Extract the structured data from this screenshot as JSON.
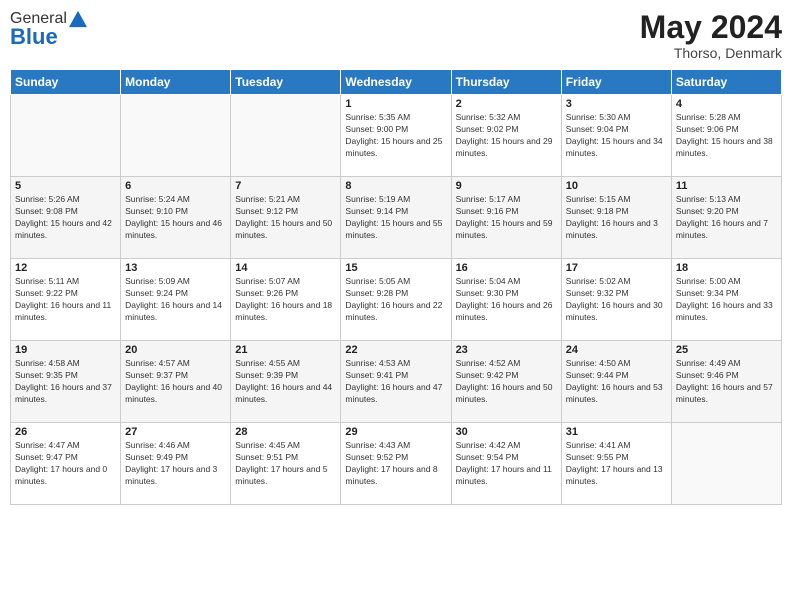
{
  "header": {
    "logo_general": "General",
    "logo_blue": "Blue",
    "month_title": "May 2024",
    "subtitle": "Thorso, Denmark"
  },
  "days_of_week": [
    "Sunday",
    "Monday",
    "Tuesday",
    "Wednesday",
    "Thursday",
    "Friday",
    "Saturday"
  ],
  "weeks": [
    [
      {
        "day": "",
        "info": ""
      },
      {
        "day": "",
        "info": ""
      },
      {
        "day": "",
        "info": ""
      },
      {
        "day": "1",
        "info": "Sunrise: 5:35 AM\nSunset: 9:00 PM\nDaylight: 15 hours and 25 minutes."
      },
      {
        "day": "2",
        "info": "Sunrise: 5:32 AM\nSunset: 9:02 PM\nDaylight: 15 hours and 29 minutes."
      },
      {
        "day": "3",
        "info": "Sunrise: 5:30 AM\nSunset: 9:04 PM\nDaylight: 15 hours and 34 minutes."
      },
      {
        "day": "4",
        "info": "Sunrise: 5:28 AM\nSunset: 9:06 PM\nDaylight: 15 hours and 38 minutes."
      }
    ],
    [
      {
        "day": "5",
        "info": "Sunrise: 5:26 AM\nSunset: 9:08 PM\nDaylight: 15 hours and 42 minutes."
      },
      {
        "day": "6",
        "info": "Sunrise: 5:24 AM\nSunset: 9:10 PM\nDaylight: 15 hours and 46 minutes."
      },
      {
        "day": "7",
        "info": "Sunrise: 5:21 AM\nSunset: 9:12 PM\nDaylight: 15 hours and 50 minutes."
      },
      {
        "day": "8",
        "info": "Sunrise: 5:19 AM\nSunset: 9:14 PM\nDaylight: 15 hours and 55 minutes."
      },
      {
        "day": "9",
        "info": "Sunrise: 5:17 AM\nSunset: 9:16 PM\nDaylight: 15 hours and 59 minutes."
      },
      {
        "day": "10",
        "info": "Sunrise: 5:15 AM\nSunset: 9:18 PM\nDaylight: 16 hours and 3 minutes."
      },
      {
        "day": "11",
        "info": "Sunrise: 5:13 AM\nSunset: 9:20 PM\nDaylight: 16 hours and 7 minutes."
      }
    ],
    [
      {
        "day": "12",
        "info": "Sunrise: 5:11 AM\nSunset: 9:22 PM\nDaylight: 16 hours and 11 minutes."
      },
      {
        "day": "13",
        "info": "Sunrise: 5:09 AM\nSunset: 9:24 PM\nDaylight: 16 hours and 14 minutes."
      },
      {
        "day": "14",
        "info": "Sunrise: 5:07 AM\nSunset: 9:26 PM\nDaylight: 16 hours and 18 minutes."
      },
      {
        "day": "15",
        "info": "Sunrise: 5:05 AM\nSunset: 9:28 PM\nDaylight: 16 hours and 22 minutes."
      },
      {
        "day": "16",
        "info": "Sunrise: 5:04 AM\nSunset: 9:30 PM\nDaylight: 16 hours and 26 minutes."
      },
      {
        "day": "17",
        "info": "Sunrise: 5:02 AM\nSunset: 9:32 PM\nDaylight: 16 hours and 30 minutes."
      },
      {
        "day": "18",
        "info": "Sunrise: 5:00 AM\nSunset: 9:34 PM\nDaylight: 16 hours and 33 minutes."
      }
    ],
    [
      {
        "day": "19",
        "info": "Sunrise: 4:58 AM\nSunset: 9:35 PM\nDaylight: 16 hours and 37 minutes."
      },
      {
        "day": "20",
        "info": "Sunrise: 4:57 AM\nSunset: 9:37 PM\nDaylight: 16 hours and 40 minutes."
      },
      {
        "day": "21",
        "info": "Sunrise: 4:55 AM\nSunset: 9:39 PM\nDaylight: 16 hours and 44 minutes."
      },
      {
        "day": "22",
        "info": "Sunrise: 4:53 AM\nSunset: 9:41 PM\nDaylight: 16 hours and 47 minutes."
      },
      {
        "day": "23",
        "info": "Sunrise: 4:52 AM\nSunset: 9:42 PM\nDaylight: 16 hours and 50 minutes."
      },
      {
        "day": "24",
        "info": "Sunrise: 4:50 AM\nSunset: 9:44 PM\nDaylight: 16 hours and 53 minutes."
      },
      {
        "day": "25",
        "info": "Sunrise: 4:49 AM\nSunset: 9:46 PM\nDaylight: 16 hours and 57 minutes."
      }
    ],
    [
      {
        "day": "26",
        "info": "Sunrise: 4:47 AM\nSunset: 9:47 PM\nDaylight: 17 hours and 0 minutes."
      },
      {
        "day": "27",
        "info": "Sunrise: 4:46 AM\nSunset: 9:49 PM\nDaylight: 17 hours and 3 minutes."
      },
      {
        "day": "28",
        "info": "Sunrise: 4:45 AM\nSunset: 9:51 PM\nDaylight: 17 hours and 5 minutes."
      },
      {
        "day": "29",
        "info": "Sunrise: 4:43 AM\nSunset: 9:52 PM\nDaylight: 17 hours and 8 minutes."
      },
      {
        "day": "30",
        "info": "Sunrise: 4:42 AM\nSunset: 9:54 PM\nDaylight: 17 hours and 11 minutes."
      },
      {
        "day": "31",
        "info": "Sunrise: 4:41 AM\nSunset: 9:55 PM\nDaylight: 17 hours and 13 minutes."
      },
      {
        "day": "",
        "info": ""
      }
    ]
  ]
}
